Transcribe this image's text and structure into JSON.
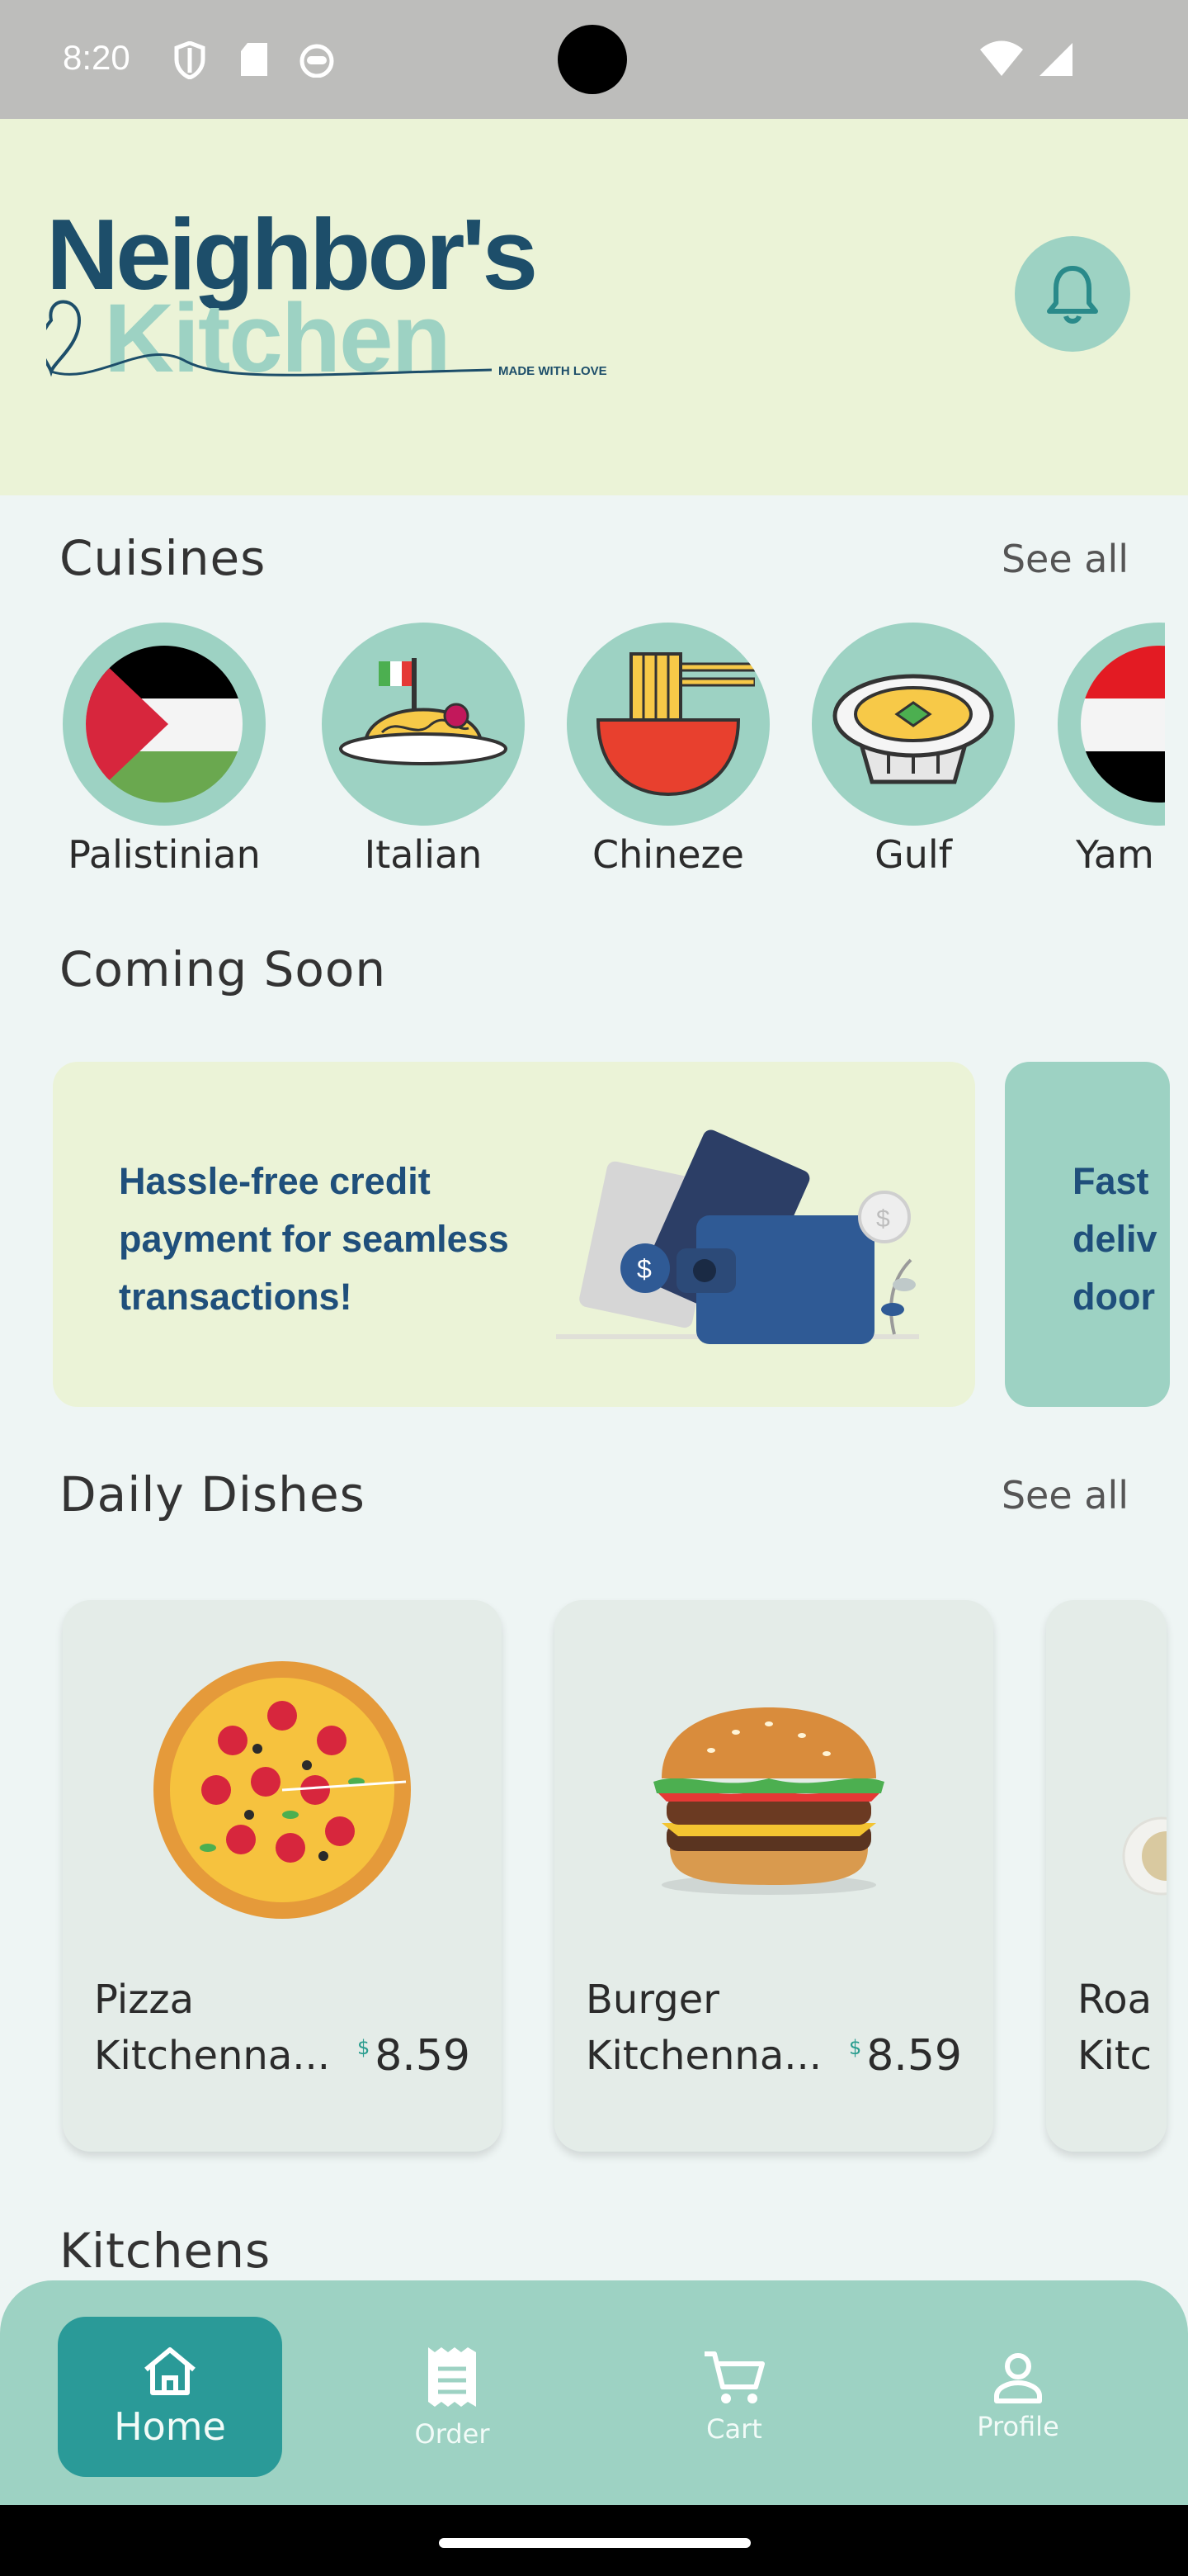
{
  "status_bar": {
    "time": "8:20"
  },
  "header": {
    "logo_line1": "Neighbor's",
    "logo_line2": "Kitchen",
    "tagline": "MADE WITH LOVE"
  },
  "cuisines": {
    "title": "Cuisines",
    "see_all": "See all",
    "items": [
      {
        "label": "Palistinian",
        "icon": "palestine-flag-icon"
      },
      {
        "label": "Italian",
        "icon": "spaghetti-icon"
      },
      {
        "label": "Chineze",
        "icon": "noodle-bowl-icon"
      },
      {
        "label": "Gulf",
        "icon": "gulf-dish-icon"
      },
      {
        "label": "Yam",
        "icon": "yemen-flag-icon"
      }
    ]
  },
  "coming_soon": {
    "title": "Coming Soon",
    "cards": [
      {
        "text": "Hassle-free credit payment for seamless transactions!",
        "bg": "#ebf3d7"
      },
      {
        "text": "Fast deliv door",
        "bg": "#9dd2c3"
      }
    ]
  },
  "daily_dishes": {
    "title": "Daily Dishes",
    "see_all": "See all",
    "items": [
      {
        "name": "Pizza",
        "kitchen": "Kitchenna...",
        "currency": "$",
        "price": "8.59"
      },
      {
        "name": "Burger",
        "kitchen": "Kitchenna...",
        "currency": "$",
        "price": "8.59"
      },
      {
        "name": "Roa",
        "kitchen": "Kitc",
        "currency": "",
        "price": ""
      }
    ]
  },
  "kitchens": {
    "title": "Kitchens"
  },
  "bottom_nav": {
    "items": [
      {
        "label": "Home",
        "icon": "home-icon",
        "active": true
      },
      {
        "label": "Order",
        "icon": "receipt-icon",
        "active": false
      },
      {
        "label": "Cart",
        "icon": "cart-icon",
        "active": false
      },
      {
        "label": "Profile",
        "icon": "person-icon",
        "active": false
      }
    ]
  },
  "colors": {
    "accent": "#2a9a98",
    "mint": "#9dd2c3",
    "header_bg": "#ebf3d7",
    "logo_navy": "#1d4e6a"
  }
}
